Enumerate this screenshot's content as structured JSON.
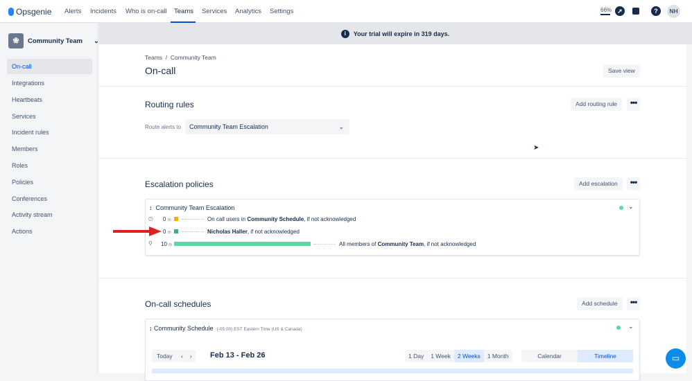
{
  "nav": {
    "brand": "Opsgenie",
    "items": [
      "Alerts",
      "Incidents",
      "Who is on-call",
      "Teams",
      "Services",
      "Analytics",
      "Settings"
    ],
    "progress": "66%",
    "progress_value": 0.66,
    "avatar": "NH"
  },
  "sidebar": {
    "team": "Community Team",
    "items": [
      "On-call",
      "Integrations",
      "Heartbeats",
      "Services",
      "Incident rules",
      "Members",
      "Roles",
      "Policies",
      "Conferences",
      "Activity stream",
      "Actions"
    ]
  },
  "banner": {
    "text": "Your trial will expire in 319 days."
  },
  "page": {
    "breadcrumb": [
      "Teams",
      "Community Team"
    ],
    "title": "On-call",
    "save_view": "Save view"
  },
  "routing": {
    "title": "Routing rules",
    "add": "Add routing rule",
    "route_label": "Route alerts to",
    "route_value": "Community Team Escalation"
  },
  "escalation": {
    "title": "Escalation policies",
    "add": "Add escalation",
    "policy": "Community Team Escalation",
    "rules": [
      {
        "delay": "0",
        "unit": "m",
        "pre": "On call users in ",
        "bold": "Community Schedule",
        "post": ", if not acknowledged",
        "color": "#ffab00"
      },
      {
        "delay": "0",
        "unit": "m",
        "pre": "",
        "bold": "Nicholas Haller",
        "post": ", if not acknowledged",
        "color": "#36b37e"
      },
      {
        "delay": "10",
        "unit": "m",
        "pre": "All members of ",
        "bold": "Community Team",
        "post": ", if not acknowledged",
        "color": "#57d9a3"
      }
    ]
  },
  "schedules": {
    "title": "On-call schedules",
    "add": "Add schedule",
    "name": "Community Schedule",
    "tz": "(-05:00) EST Eastern Time (US & Canada)",
    "today": "Today",
    "range": "Feb 13 - Feb 26",
    "views": [
      "1 Day",
      "1 Week",
      "2 Weeks",
      "1 Month"
    ],
    "modes": [
      "Calendar",
      "Timeline"
    ]
  }
}
